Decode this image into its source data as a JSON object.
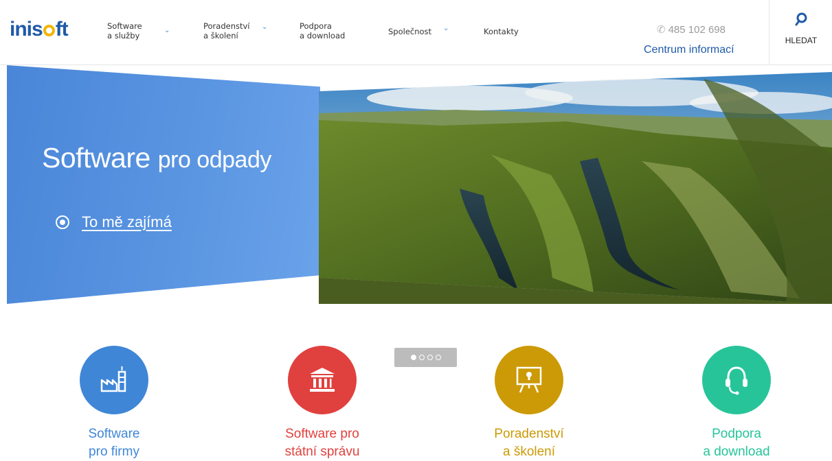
{
  "header": {
    "logo": {
      "pre": "inis",
      "post": "ft"
    },
    "nav": [
      {
        "line1": "Software",
        "line2": "a služby",
        "has_dropdown": true
      },
      {
        "line1": "Poradenství",
        "line2": "a školení",
        "has_dropdown": true
      },
      {
        "line1": "Podpora",
        "line2": "a download",
        "has_dropdown": false
      },
      {
        "line1": "Společnost",
        "line2": "",
        "has_dropdown": true
      },
      {
        "line1": "Kontakty",
        "line2": "",
        "has_dropdown": false
      }
    ],
    "phone": "485 102 698",
    "info_link": "Centrum informací",
    "search_label": "HLEDAT"
  },
  "hero": {
    "title_main": "Software",
    "title_rest": "pro odpady",
    "cta": "To mě zajímá",
    "slides_total": 4,
    "active_slide": 1
  },
  "tiles": [
    {
      "line1": "Software",
      "line2": "pro firmy",
      "color": "#3f86d6",
      "icon": "factory-icon"
    },
    {
      "line1": "Software pro",
      "line2": "státní správu",
      "color": "#e0413e",
      "icon": "government-building-icon"
    },
    {
      "line1": "Poradenství",
      "line2": "a školení",
      "color": "#cc9a06",
      "icon": "presentation-board-icon"
    },
    {
      "line1": "Podpora",
      "line2": "a download",
      "color": "#27c49a",
      "icon": "headset-icon"
    }
  ],
  "colors": {
    "brand_blue": "#1e5aa8",
    "logo_ring": "#f2b600",
    "hero_blue": "#5b96e2",
    "tile_text_1": "#3f86d6",
    "tile_text_2": "#e0413e",
    "tile_text_3": "#cc9a06",
    "tile_text_4": "#27c49a"
  }
}
